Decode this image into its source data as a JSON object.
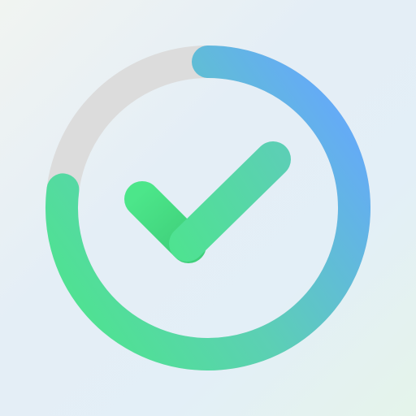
{
  "icon": {
    "name": "progress-ring-checkmark-icon",
    "progress_fraction": 0.77,
    "colors": {
      "track": "#dcdcdc",
      "gradient_start": "#4ce68a",
      "gradient_mid": "#5ccfb5",
      "gradient_end": "#66a6ff",
      "background_light": "#e4eef6"
    }
  }
}
